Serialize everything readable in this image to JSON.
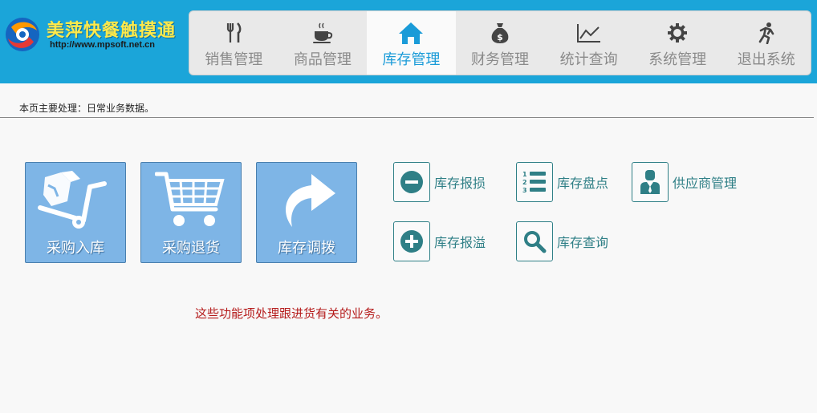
{
  "app": {
    "title": "美萍快餐触摸通",
    "url": "http://www.mpsoft.net.cn"
  },
  "nav": [
    {
      "label": "销售管理",
      "icon": "fork-knife-icon",
      "active": false
    },
    {
      "label": "商品管理",
      "icon": "coffee-cup-icon",
      "active": false
    },
    {
      "label": "库存管理",
      "icon": "home-icon",
      "active": true
    },
    {
      "label": "财务管理",
      "icon": "money-bag-icon",
      "active": false
    },
    {
      "label": "统计查询",
      "icon": "line-chart-icon",
      "active": false
    },
    {
      "label": "系统管理",
      "icon": "gear-icon",
      "active": false
    },
    {
      "label": "退出系统",
      "icon": "running-person-icon",
      "active": false
    }
  ],
  "page_info": "本页主要处理：日常业务数据。",
  "big_buttons": [
    {
      "label": "采购入库",
      "icon": "hand-truck-icon"
    },
    {
      "label": "采购退货",
      "icon": "shopping-cart-icon"
    },
    {
      "label": "库存调拨",
      "icon": "curved-arrow-icon"
    }
  ],
  "small_buttons": [
    {
      "label": "库存报损",
      "icon": "minus-circle-icon"
    },
    {
      "label": "库存盘点",
      "icon": "numbered-list-icon"
    },
    {
      "label": "供应商管理",
      "icon": "businessman-icon"
    },
    {
      "label": "库存报溢",
      "icon": "plus-circle-icon"
    },
    {
      "label": "库存查询",
      "icon": "search-icon"
    }
  ],
  "note": "这些功能项处理跟进货有关的业务。",
  "colors": {
    "header": "#1ba5d9",
    "active_tab_text": "#1a9bd8",
    "tile": "#7eb5e6",
    "teal": "#2f7f86",
    "note": "#b51b1b"
  }
}
